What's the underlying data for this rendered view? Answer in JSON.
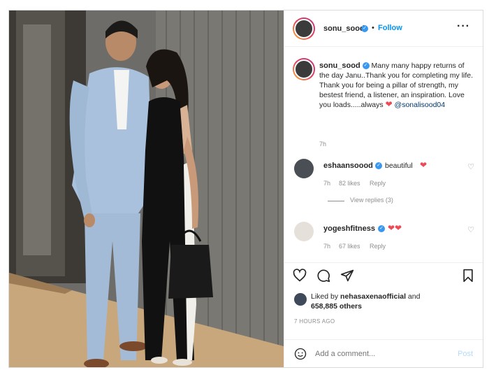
{
  "post": {
    "username": "sonu_sood",
    "follow_label": "Follow",
    "more_icon": "more-horizontal-icon",
    "caption": {
      "username": "sonu_sood",
      "text": "Many many happy returns of the day Janu..Thank you for completing my life. Thank you for being a pillar of strength, my bestest friend, a listener, an inspiration. Love you loads.....always",
      "mention": "@sonalisood04",
      "time": "7h"
    },
    "comments": [
      {
        "username": "eshaansoood",
        "text": "beautiful",
        "hearts": 1,
        "time": "7h",
        "likes": "82 likes",
        "reply_label": "Reply",
        "view_replies": "View replies (3)"
      },
      {
        "username": "yogeshfitness",
        "text": "",
        "hearts": 2,
        "time": "7h",
        "likes": "67 likes",
        "reply_label": "Reply"
      }
    ],
    "actions": {
      "like_icon": "heart-outline-icon",
      "comment_icon": "comment-icon",
      "share_icon": "paper-plane-icon",
      "save_icon": "bookmark-icon"
    },
    "liked_by": {
      "prefix": "Liked by",
      "user": "nehasaxenaofficial",
      "joiner": "and",
      "others": "658,885 others"
    },
    "timestamp": "7 HOURS AGO",
    "add_comment": {
      "emoji_icon": "smiley-icon",
      "placeholder": "Add a comment...",
      "post_label": "Post"
    }
  },
  "colors": {
    "link_blue": "#0095f6",
    "verified_blue": "#3897f0",
    "heart_red": "#ed4956",
    "muted_gray": "#8e8e8e"
  }
}
